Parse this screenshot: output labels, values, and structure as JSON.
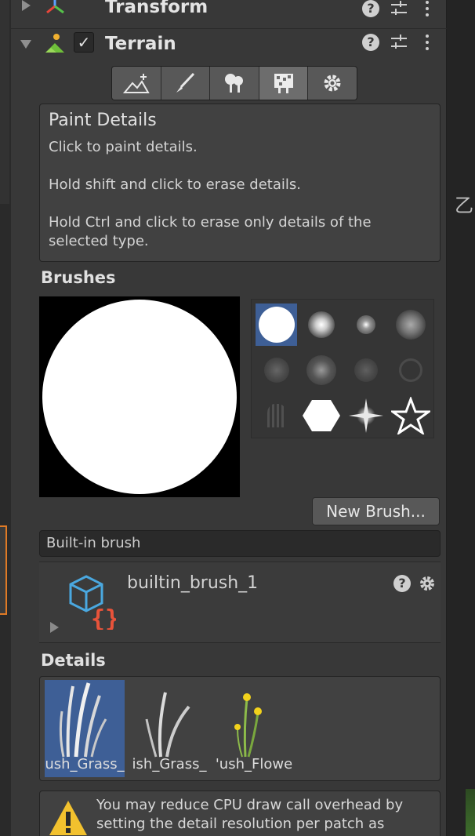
{
  "components": {
    "transform": {
      "title": "Transform"
    },
    "terrain": {
      "title": "Terrain",
      "enabled": "✓"
    }
  },
  "paint_details": {
    "title": "Paint Details",
    "lines": [
      "Click to paint details.",
      "Hold shift and click to erase details.",
      "Hold Ctrl and click to erase only details of the selected type."
    ]
  },
  "brushes": {
    "label": "Brushes",
    "new_brush_label": "New Brush...",
    "builtin_field": "Built-in brush",
    "asset_name": "builtin_brush_1"
  },
  "details": {
    "label": "Details",
    "items": [
      {
        "label": "ush_Grass_",
        "selected": true
      },
      {
        "label": "ish_Grass_",
        "selected": false
      },
      {
        "label": "'ush_Flowe",
        "selected": false
      }
    ]
  },
  "warning": {
    "text": "You may reduce CPU draw call overhead by setting the detail resolution per patch as"
  },
  "side": {
    "right_glyph": "乙"
  },
  "colors": {
    "selection": "#3e5f96",
    "panel": "#383838",
    "accent_orange": "#e07a25"
  }
}
